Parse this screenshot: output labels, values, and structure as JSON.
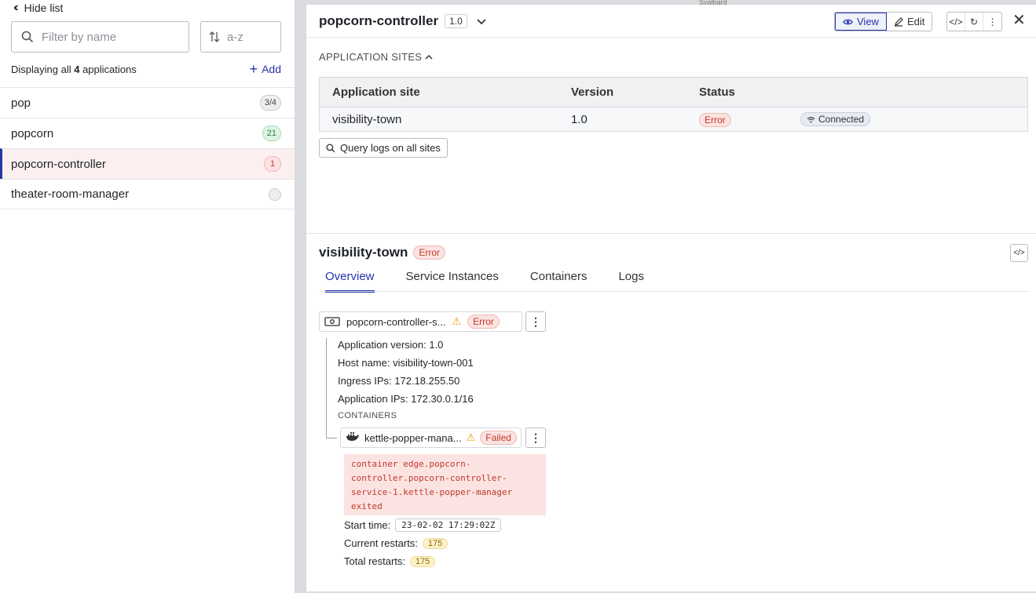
{
  "sidebar": {
    "hide_list": "Hide list",
    "filter_placeholder": "Filter by name",
    "sort_label": "a-z",
    "display_prefix": "Displaying all",
    "display_count": "4",
    "display_suffix": "applications",
    "add_label": "Add",
    "items": [
      {
        "name": "pop",
        "badge": "3/4"
      },
      {
        "name": "popcorn",
        "badge": "21"
      },
      {
        "name": "popcorn-controller",
        "badge": "1"
      },
      {
        "name": "theater-room-manager",
        "badge": ""
      }
    ]
  },
  "map": {
    "label": "Svalbard"
  },
  "panel": {
    "title": "popcorn-controller",
    "version": "1.0",
    "view_label": "View",
    "edit_label": "Edit",
    "sites_label": "APPLICATION SITES",
    "table": {
      "headers": [
        "Application site",
        "Version",
        "Status"
      ],
      "rows": [
        {
          "site": "visibility-town",
          "version": "1.0",
          "status": "Error",
          "connection": "Connected"
        }
      ]
    },
    "query_button": "Query logs on all sites"
  },
  "site": {
    "title": "visibility-town",
    "status": "Error",
    "tabs": [
      "Overview",
      "Service Instances",
      "Containers",
      "Logs"
    ],
    "service": {
      "name": "popcorn-controller-s...",
      "status": "Error"
    },
    "details": {
      "app_version": "Application version: 1.0",
      "host_name": "Host name: visibility-town-001",
      "ingress_ips": "Ingress IPs: 172.18.255.50",
      "app_ips": "Application IPs: 172.30.0.1/16"
    },
    "containers_label": "CONTAINERS",
    "container": {
      "name": "kettle-popper-mana...",
      "status": "Failed",
      "error": "container edge.popcorn-controller.popcorn-controller-service-1.kettle-popper-manager exited",
      "start_time_label": "Start time:",
      "start_time": "23-02-02 17:29:02Z",
      "current_restarts_label": "Current restarts:",
      "current_restarts": "175",
      "total_restarts_label": "Total restarts:",
      "total_restarts": "175"
    }
  },
  "colors": {
    "accent": "#2635a8",
    "error": "#c0392b",
    "warning": "#e0a100"
  }
}
